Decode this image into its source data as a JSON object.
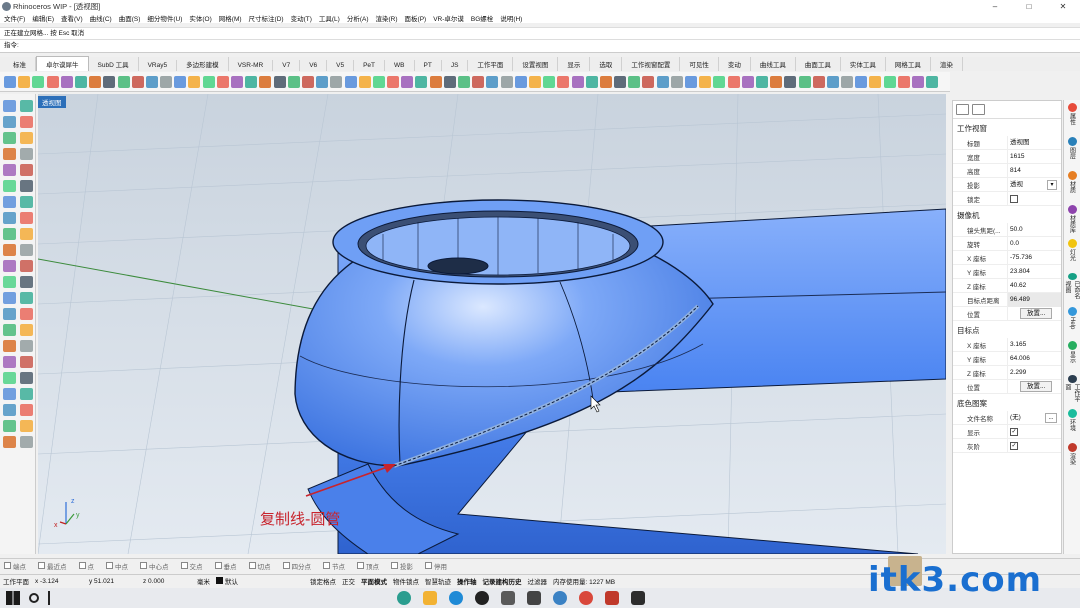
{
  "window": {
    "title": "Rhinoceros WIP - [透视图]",
    "controls": [
      "–",
      "□",
      "✕"
    ]
  },
  "menu": [
    "文件(F)",
    "编辑(E)",
    "查看(V)",
    "曲线(C)",
    "曲面(S)",
    "细分物件(U)",
    "实体(O)",
    "网格(M)",
    "尺寸标注(D)",
    "变动(T)",
    "工具(L)",
    "分析(A)",
    "渲染(R)",
    "面板(P)",
    "VR-卓尔谟",
    "BG螺栓",
    "说明(H)"
  ],
  "command": {
    "history": "正在建立网格... 按 Esc 取消",
    "prompt": "指令:"
  },
  "tabs": [
    "标准",
    "卓尔谟犀牛",
    "SubD 工具",
    "VRay5",
    "多边形建模",
    "VSR-MR",
    "V7",
    "V6",
    "V5",
    "PeT",
    "WB",
    "PT",
    "JS",
    "工作平面",
    "设置视图",
    "显示",
    "选取",
    "工作视窗配置",
    "可见性",
    "变动",
    "曲线工具",
    "曲面工具",
    "实体工具",
    "网格工具",
    "渲染"
  ],
  "active_tab": "卓尔谟犀牛",
  "viewport": {
    "label": "透视图",
    "annotation": "复制线-圆管",
    "axis_x": "x",
    "axis_y": "y",
    "axis_z": "z"
  },
  "properties": {
    "section_viewport": "工作视窗",
    "viewport_rows": [
      {
        "k": "标题",
        "v": "透视图"
      },
      {
        "k": "宽度",
        "v": "1615"
      },
      {
        "k": "高度",
        "v": "814"
      },
      {
        "k": "投影",
        "v": "透视"
      },
      {
        "k": "锁定",
        "v": ""
      }
    ],
    "section_camera": "摄像机",
    "camera_rows": [
      {
        "k": "镜头焦距(...",
        "v": "50.0"
      },
      {
        "k": "旋转",
        "v": "0.0"
      },
      {
        "k": "X 座标",
        "v": "-75.736"
      },
      {
        "k": "Y 座标",
        "v": "23.804"
      },
      {
        "k": "Z 座标",
        "v": "40.62"
      },
      {
        "k": "目标点距离",
        "v": "96.489"
      }
    ],
    "position_label": "位置",
    "place_button": "放置...",
    "section_target": "目标点",
    "target_rows": [
      {
        "k": "X 座标",
        "v": "3.165"
      },
      {
        "k": "Y 座标",
        "v": "64.006"
      },
      {
        "k": "Z 座标",
        "v": "2.299"
      }
    ],
    "section_background": "底色图案",
    "bg_filename_label": "文件名称",
    "bg_filename_value": "(无)",
    "bg_show_label": "显示",
    "bg_gray_label": "灰阶",
    "checked_mark": "✓"
  },
  "right_panel_tabs": [
    "属性",
    "图层",
    "材质",
    "材质库",
    "灯光",
    "已命名视图",
    "Help",
    "显示",
    "工作平面",
    "环境",
    "渲染"
  ],
  "osnap": {
    "items": [
      "端点",
      "最近点",
      "点",
      "中点",
      "中心点",
      "交点",
      "垂点",
      "切点",
      "四分点",
      "节点",
      "顶点",
      "投影"
    ],
    "disable_label": "停用"
  },
  "status": {
    "cplane": "工作平面",
    "x": "x -3.124",
    "y": "y 51.021",
    "z": "z 0.000",
    "unit": "毫米",
    "layer": "默认",
    "toggles": [
      "锁定格点",
      "正交",
      "平面模式",
      "物件锁点",
      "智慧轨迹",
      "操作轴",
      "记录建构历史",
      "过滤器"
    ],
    "memory": "内存使用量: 1227 MB"
  },
  "watermark": "itk3.com",
  "colors": {
    "accent": "#2c6fb9",
    "model_blue": "#4a86f0",
    "annotation_red": "#c8232c",
    "background": "#d7e0ea"
  }
}
